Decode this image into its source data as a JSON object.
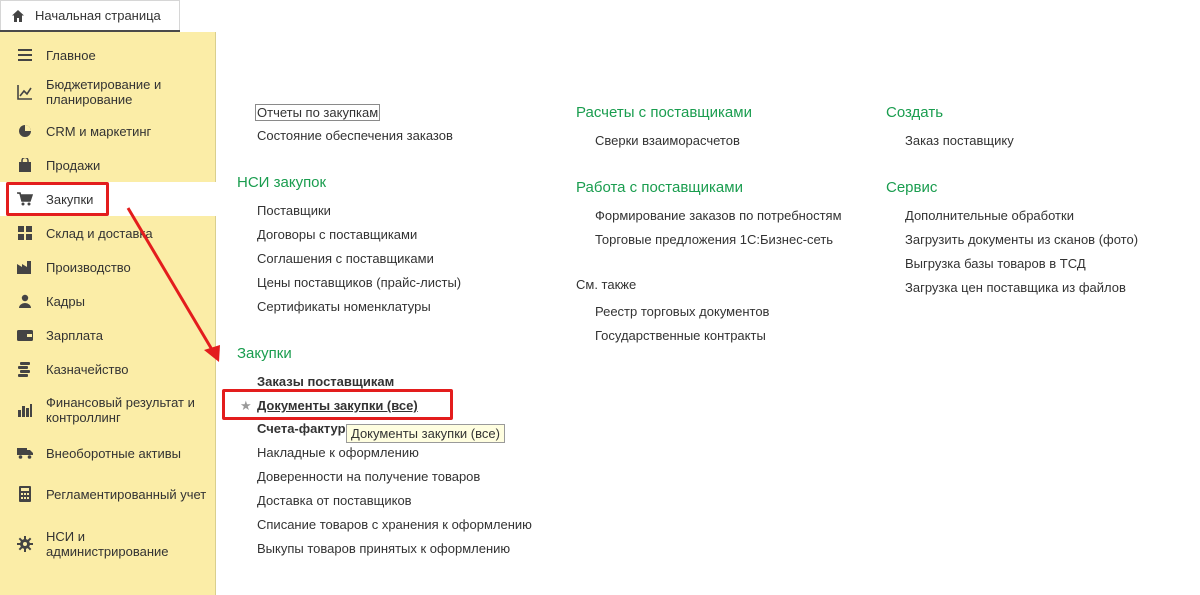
{
  "home_tab": {
    "label": "Начальная страница",
    "icon": "home-icon"
  },
  "sidebar": {
    "items": [
      {
        "label": "Главное",
        "icon": "menu-lines-icon"
      },
      {
        "label": "Бюджетирование и планирование",
        "icon": "chart-line-icon"
      },
      {
        "label": "CRM и маркетинг",
        "icon": "pie-chart-icon"
      },
      {
        "label": "Продажи",
        "icon": "shopping-bag-icon"
      },
      {
        "label": "Закупки",
        "icon": "cart-icon",
        "active": true
      },
      {
        "label": "Склад и доставка",
        "icon": "warehouse-grid-icon"
      },
      {
        "label": "Производство",
        "icon": "factory-icon"
      },
      {
        "label": "Кадры",
        "icon": "person-icon"
      },
      {
        "label": "Зарплата",
        "icon": "wallet-icon"
      },
      {
        "label": "Казначейство",
        "icon": "coins-icon"
      },
      {
        "label": "Финансовый результат и контроллинг",
        "icon": "bar-chart-icon"
      },
      {
        "label": "Внеоборотные активы",
        "icon": "truck-icon"
      },
      {
        "label": "Регламентированный учет",
        "icon": "calculator-icon"
      },
      {
        "label": "НСИ и администрирование",
        "icon": "gear-icon"
      }
    ]
  },
  "col1": {
    "top_links": [
      "Отчеты по закупкам",
      "Состояние обеспечения заказов"
    ],
    "nsi_title": "НСИ закупок",
    "nsi_links": [
      "Поставщики",
      "Договоры с поставщиками",
      "Соглашения с поставщиками",
      "Цены поставщиков (прайс-листы)",
      "Сертификаты номенклатуры"
    ],
    "purchases_title": "Закупки",
    "purchases_links": [
      "Заказы поставщикам",
      "Документы закупки (все)",
      "Счета-фактур",
      "Накладные к оформлению",
      "Доверенности на получение товаров",
      "Доставка от поставщиков",
      "Списание товаров с хранения к оформлению",
      "Выкупы товаров принятых к оформлению"
    ]
  },
  "col2": {
    "settlements_title": "Расчеты с поставщиками",
    "settlements_links": [
      "Сверки взаиморасчетов"
    ],
    "work_title": "Работа с поставщиками",
    "work_links": [
      "Формирование заказов по потребностям",
      "Торговые предложения 1С:Бизнес-сеть"
    ],
    "see_also": "См. также",
    "see_also_links": [
      "Реестр торговых документов",
      "Государственные контракты"
    ]
  },
  "col3": {
    "create_title": "Создать",
    "create_links": [
      "Заказ поставщику"
    ],
    "service_title": "Сервис",
    "service_links": [
      "Дополнительные обработки",
      "Загрузить документы из сканов (фото)",
      "Выгрузка базы товаров в ТСД",
      "Загрузка цен поставщика из файлов"
    ]
  },
  "tooltip": "Документы закупки (все)",
  "colors": {
    "accent_green": "#1a9d4f",
    "sidebar_bg": "#fbeda7",
    "highlight_red": "#e31d1d"
  }
}
